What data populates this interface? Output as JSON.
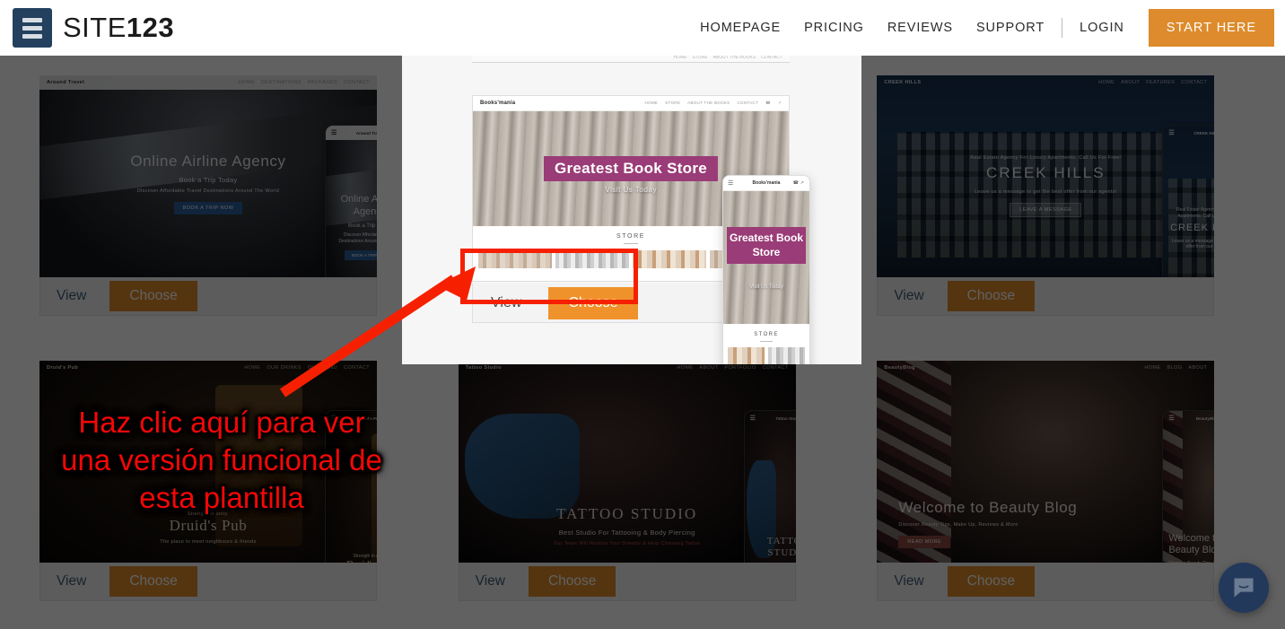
{
  "header": {
    "logo_text_thin": "SITE",
    "logo_text_bold": "123",
    "logo_icon": "site123-logo-icon",
    "nav": [
      {
        "label": "HOMEPAGE"
      },
      {
        "label": "PRICING"
      },
      {
        "label": "REVIEWS"
      },
      {
        "label": "SUPPORT"
      },
      {
        "label": "LOGIN"
      }
    ],
    "cta_label": "START HERE",
    "cta_color": "#dd8b2c"
  },
  "cards": [
    {
      "brand": "Around Travel",
      "title": "Online Airline Agency",
      "subtitle": "Book a Trip Today",
      "tagline": "Discover Affordable Travel Destinations Around The World",
      "cta": "BOOK A TRIP NOW",
      "nav": [
        "HOME",
        "DESTINATIONS",
        "PACKAGES",
        "CONTACT"
      ],
      "view_label": "View",
      "choose_label": "Choose"
    },
    {
      "brand": "Books'mania",
      "title": "Greatest Book Store",
      "subtitle": "Visit Us Today",
      "tagline": "",
      "cta": "",
      "nav": [
        "HOME",
        "STORE",
        "ABOUT THE BOOKS",
        "CONTACT"
      ],
      "view_label": "View",
      "choose_label": "Choose"
    },
    {
      "brand": "CREEK HILLS",
      "title": "CREEK HILLS",
      "subtitle": "Real Estate Agency For Luxury Apartments. Call Us For Free!",
      "tagline": "Leave us a message to get the best offer from our agents!",
      "cta": "LEAVE A MESSAGE",
      "nav": [
        "HOME",
        "ABOUT",
        "FEATURES",
        "CONTACT"
      ],
      "view_label": "View",
      "choose_label": "Choose"
    },
    {
      "brand": "Druid's Pub",
      "title": "Druid's Pub",
      "subtitle": "The place to meet neighbours & friends",
      "tagline": "Strength in unity.",
      "cta": "",
      "nav": [
        "HOME",
        "OUR DRINKS",
        "OUR MENU",
        "CONTACT"
      ],
      "view_label": "View",
      "choose_label": "Choose"
    },
    {
      "brand": "Tattoo Studio",
      "title": "TATTOO STUDIO",
      "subtitle": "Best Studio For Tattooing & Body Piercing",
      "tagline": "Our Team Will Realize Your Dreams & Help Choosing Tattoo",
      "cta": "",
      "nav": [
        "HOME",
        "ABOUT",
        "PORTFOLIO",
        "CONTACT"
      ],
      "view_label": "View",
      "choose_label": "Choose"
    },
    {
      "brand": "BeautyBlog",
      "title": "Welcome to Beauty Blog",
      "subtitle": "Discover Beauty Tips, Make Up, Reviews & More",
      "tagline": "",
      "cta": "READ MORE",
      "nav": [
        "HOME",
        "BLOG",
        "ABOUT"
      ],
      "view_label": "View",
      "choose_label": "Choose"
    }
  ],
  "modal": {
    "template": {
      "brand": "Books'mania",
      "nav": [
        "HOME",
        "STORE",
        "ABOUT THE BOOKS",
        "CONTACT"
      ],
      "hero_title": "Greatest Book Store",
      "hero_subtitle": "Visit Us Today",
      "hero_title_color": "#9a3c77",
      "section_label": "STORE",
      "view_label": "View",
      "choose_label": "Choose",
      "choose_color": "#f0922b"
    },
    "mobile": {
      "brand": "Books'mania",
      "hero_title": "Greatest Book Store",
      "hero_subtitle": "Visit Us Today",
      "section_label": "STORE",
      "menu_icon": "hamburger-icon",
      "phone_icon": "phone-icon",
      "share_icon": "share-icon"
    }
  },
  "annotation": {
    "text": "Haz clic aquí para ver una versión funcional de esta plantilla",
    "color": "#f50707",
    "highlight_color": "#f62000",
    "arrow_icon": "red-arrow-icon"
  },
  "chat": {
    "icon": "chat-bubble-icon",
    "color": "#23395b"
  }
}
